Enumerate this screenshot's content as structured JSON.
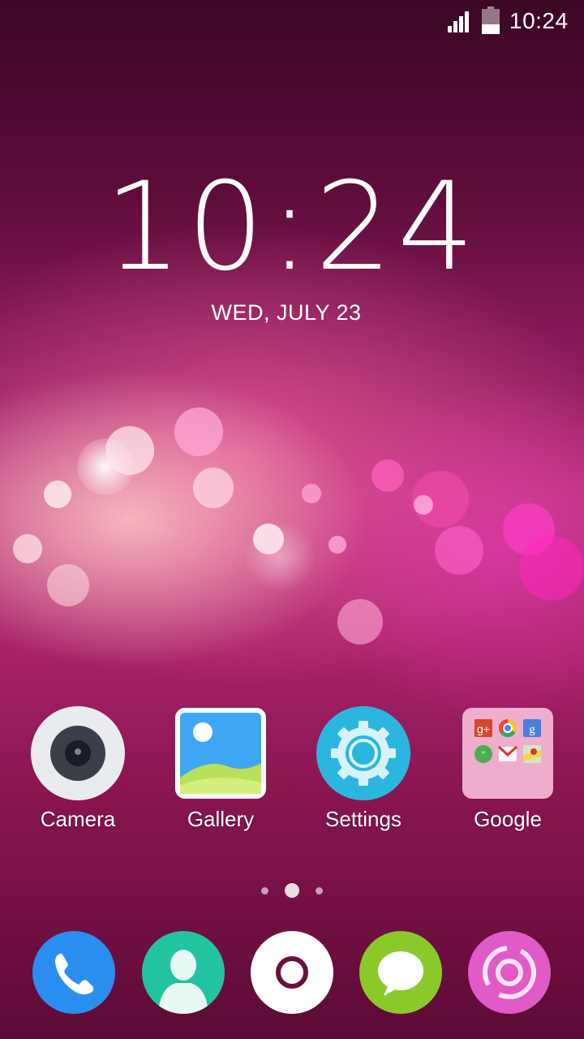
{
  "status_bar": {
    "time": "10:24",
    "signal_icon": "signal-bars-icon",
    "battery_icon": "battery-icon"
  },
  "lockscreen": {
    "clock": "10:24",
    "date": "WED, JULY 23"
  },
  "apps": [
    {
      "label": "Camera",
      "icon": "camera-icon"
    },
    {
      "label": "Gallery",
      "icon": "gallery-icon"
    },
    {
      "label": "Settings",
      "icon": "settings-gear-icon"
    },
    {
      "label": "Google",
      "icon": "google-folder-icon"
    }
  ],
  "pager": {
    "pages": 3,
    "current": 2
  },
  "dock": [
    {
      "icon": "phone-icon",
      "color": "#2a8ef0"
    },
    {
      "icon": "contacts-icon",
      "color": "#22c3a0"
    },
    {
      "icon": "home-circle-icon",
      "color": "#ffffff"
    },
    {
      "icon": "messages-icon",
      "color": "#8bc92a"
    },
    {
      "icon": "browser-orbit-icon",
      "color": "#e05ac8"
    }
  ],
  "colors": {
    "wallpaper_top": "#3c0724",
    "wallpaper_mid": "#b23276",
    "wallpaper_bottom": "#5c0a35"
  }
}
